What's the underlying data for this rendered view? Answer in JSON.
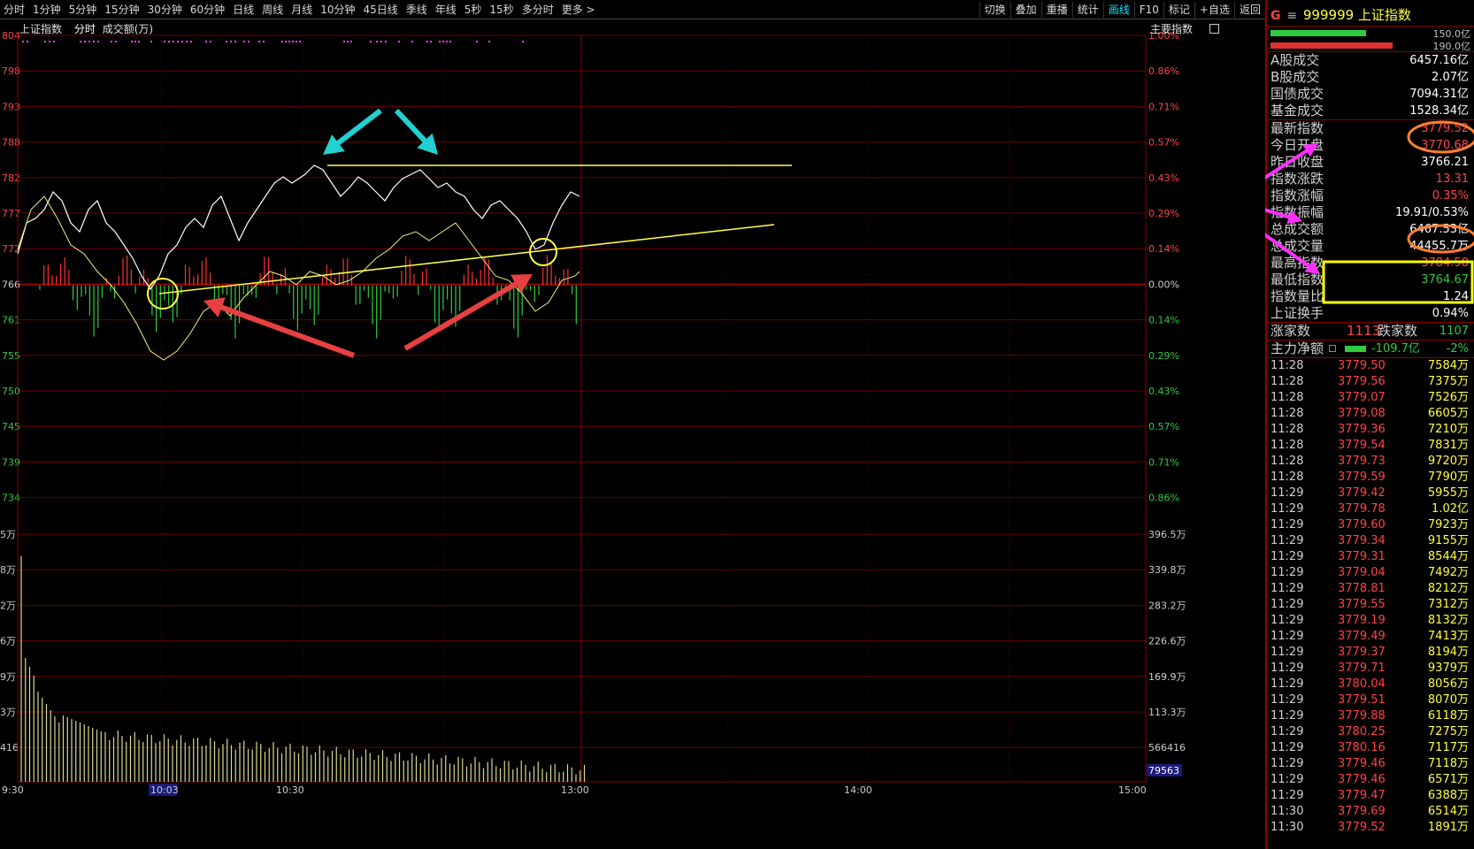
{
  "toolbar": {
    "period_tabs": [
      "分时",
      "1分钟",
      "5分钟",
      "15分钟",
      "30分钟",
      "60分钟",
      "日线",
      "周线",
      "月线",
      "10分钟",
      "45日线",
      "季线",
      "年线",
      "5秒",
      "15秒",
      "多分时",
      "更多 >"
    ],
    "tool_buttons": [
      "切换",
      "叠加",
      "重播",
      "统计",
      "画线",
      "F10",
      "标记",
      "+自选",
      "返回"
    ],
    "active_tool": "画线"
  },
  "infobar": {
    "indicator_name": "上证指数",
    "view_mode": "分时",
    "volume_label": "成交额(万)",
    "main_indicator": "主要指数"
  },
  "axes": {
    "price_left_labels": [
      "804",
      "798",
      "793",
      "788",
      "782",
      "777",
      "772",
      "766",
      "761",
      "755",
      "750",
      "745",
      "739",
      "734"
    ],
    "pct_right_labels": [
      "1.00%",
      "0.86%",
      "0.71%",
      "0.57%",
      "0.43%",
      "0.29%",
      "0.14%",
      "0.00%",
      "0.14%",
      "0.29%",
      "0.43%",
      "0.57%",
      "0.71%",
      "0.86%"
    ],
    "vol_left_labels": [
      "5万",
      "8万",
      "2万",
      "6万",
      "9万",
      "3万",
      "416"
    ],
    "vol_right_labels": [
      "396.5万",
      "339.8万",
      "283.2万",
      "226.6万",
      "169.9万",
      "113.3万",
      "566416"
    ],
    "vol_current": "79563",
    "time_labels": [
      "9:30",
      "10:03",
      "10:30",
      "13:00",
      "14:00",
      "15:00"
    ],
    "time_cursor": "10:03"
  },
  "sidebar": {
    "header_g": "G",
    "header_menu": "≡",
    "title": "999999 上证指数",
    "bar_top": {
      "value": "150.0亿",
      "color": "#2ecc40",
      "fill": 0.47
    },
    "bar_bottom": {
      "value": "190.0亿",
      "color": "#e03030",
      "fill": 0.6
    },
    "stats": [
      {
        "label": "A股成交",
        "value": "6457.16亿",
        "color": "white"
      },
      {
        "label": "B股成交",
        "value": "2.07亿",
        "color": "white"
      },
      {
        "label": "国债成交",
        "value": "7094.31亿",
        "color": "white"
      },
      {
        "label": "基金成交",
        "value": "1528.34亿",
        "color": "white"
      }
    ],
    "index_stats": [
      {
        "label": "最新指数",
        "value": "3779.52",
        "color": "red"
      },
      {
        "label": "今日开盘",
        "value": "3770.68",
        "color": "red"
      },
      {
        "label": "昨日收盘",
        "value": "3766.21",
        "color": "white"
      },
      {
        "label": "指数涨跌",
        "value": "13.31",
        "color": "red"
      },
      {
        "label": "指数涨幅",
        "value": "0.35%",
        "color": "red"
      },
      {
        "label": "指数振幅",
        "value": "19.91/0.53%",
        "color": "white"
      },
      {
        "label": "总成交额",
        "value": "6467.53亿",
        "color": "white"
      },
      {
        "label": "总成交量",
        "value": "44455.7万",
        "color": "white"
      },
      {
        "label": "最高指数",
        "value": "3784.58",
        "color": "red"
      },
      {
        "label": "最低指数",
        "value": "3764.67",
        "color": "green"
      },
      {
        "label": "指数量比",
        "value": "1.24",
        "color": "white"
      },
      {
        "label": "上证换手",
        "value": "0.94%",
        "color": "white"
      }
    ],
    "breadth": {
      "up_label": "涨家数",
      "up_value": "1113",
      "down_label": "跌家数",
      "down_value": "1107"
    },
    "net_flow": {
      "label": "主力净额",
      "value": "-109.7亿",
      "pct": "-2%"
    },
    "ticks": [
      [
        "11:28",
        "3779.50",
        "7584万"
      ],
      [
        "11:28",
        "3779.56",
        "7375万"
      ],
      [
        "11:28",
        "3779.07",
        "7526万"
      ],
      [
        "11:28",
        "3779.08",
        "6605万"
      ],
      [
        "11:28",
        "3779.36",
        "7210万"
      ],
      [
        "11:28",
        "3779.54",
        "7831万"
      ],
      [
        "11:28",
        "3779.73",
        "9720万"
      ],
      [
        "11:28",
        "3779.59",
        "7790万"
      ],
      [
        "11:29",
        "3779.42",
        "5955万"
      ],
      [
        "11:29",
        "3779.78",
        "1.02亿"
      ],
      [
        "11:29",
        "3779.60",
        "7923万"
      ],
      [
        "11:29",
        "3779.34",
        "9155万"
      ],
      [
        "11:29",
        "3779.31",
        "8544万"
      ],
      [
        "11:29",
        "3779.04",
        "7492万"
      ],
      [
        "11:29",
        "3778.81",
        "8212万"
      ],
      [
        "11:29",
        "3779.55",
        "7312万"
      ],
      [
        "11:29",
        "3779.19",
        "8132万"
      ],
      [
        "11:29",
        "3779.49",
        "7413万"
      ],
      [
        "11:29",
        "3779.37",
        "8194万"
      ],
      [
        "11:29",
        "3779.71",
        "9379万"
      ],
      [
        "11:29",
        "3780.04",
        "8056万"
      ],
      [
        "11:29",
        "3779.51",
        "8070万"
      ],
      [
        "11:29",
        "3779.88",
        "6118万"
      ],
      [
        "11:29",
        "3780.25",
        "7275万"
      ],
      [
        "11:29",
        "3780.16",
        "7117万"
      ],
      [
        "11:29",
        "3779.46",
        "7118万"
      ],
      [
        "11:29",
        "3779.46",
        "6571万"
      ],
      [
        "11:29",
        "3779.47",
        "6388万"
      ],
      [
        "11:30",
        "3779.69",
        "6514万"
      ],
      [
        "11:30",
        "3779.52",
        "1891万"
      ]
    ]
  }
}
